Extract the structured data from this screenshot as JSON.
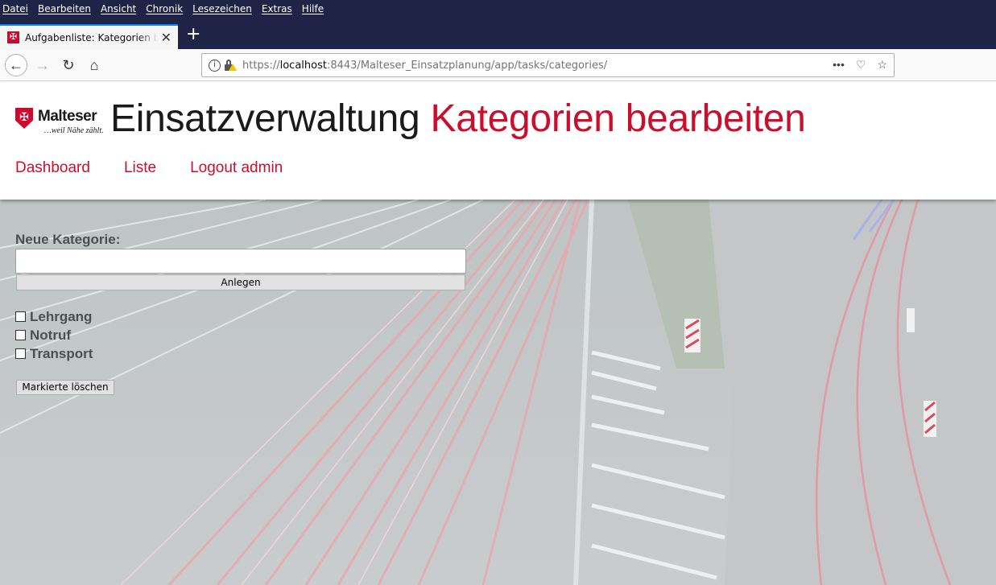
{
  "browser": {
    "menu": [
      "Datei",
      "Bearbeiten",
      "Ansicht",
      "Chronik",
      "Lesezeichen",
      "Extras",
      "Hilfe"
    ],
    "tab_title": "Aufgabenliste: Kategorien bearbeiten",
    "url_prefix": "https://",
    "url_host": "localhost",
    "url_rest": ":8443/Malteser_Einsatzplanung/app/tasks/categories/"
  },
  "header": {
    "logo_name": "Malteser",
    "logo_tagline": "…weil Nähe zählt.",
    "title_main": "Einsatzverwaltung",
    "title_accent": "Kategorien bearbeiten",
    "nav": [
      "Dashboard",
      "Liste",
      "Logout admin"
    ]
  },
  "form": {
    "label": "Neue Kategorie:",
    "input_value": "",
    "create_button": "Anlegen",
    "categories": [
      {
        "label": "Lehrgang",
        "checked": false
      },
      {
        "label": "Notruf",
        "checked": false
      },
      {
        "label": "Transport",
        "checked": false
      }
    ],
    "delete_button": "Markierte löschen"
  },
  "colors": {
    "brand_red": "#c8102e",
    "chrome_dark": "#1f2346"
  }
}
